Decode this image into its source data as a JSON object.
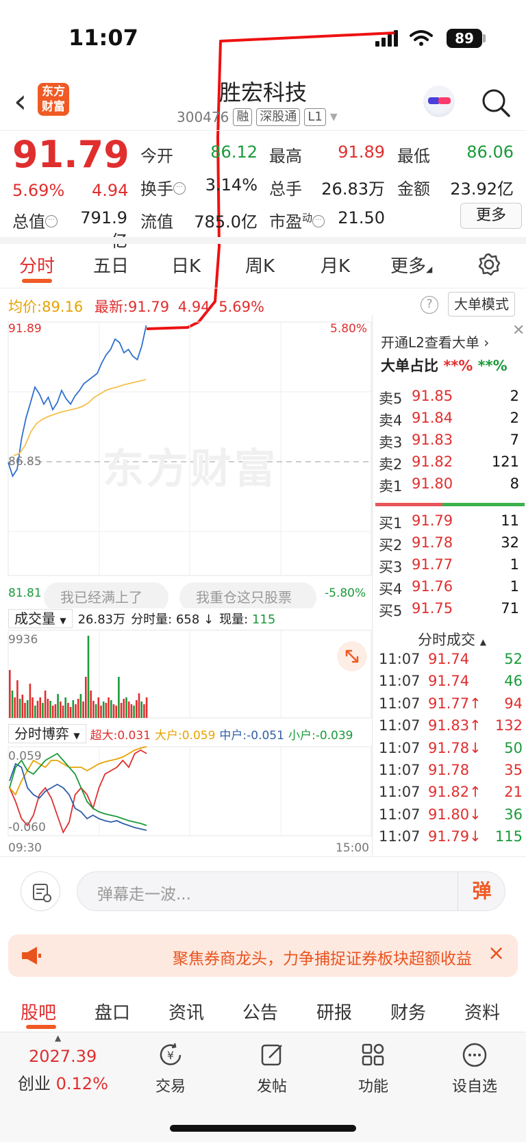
{
  "status_bar": {
    "time": "11:07",
    "battery": "89"
  },
  "header": {
    "logo_line1": "东方",
    "logo_line2": "财富",
    "name": "胜宏科技",
    "code": "300476",
    "tags": [
      "融",
      "深股通",
      "L1"
    ]
  },
  "quote": {
    "price": "91.79",
    "change_pct": "5.69%",
    "change": "4.94",
    "rows": [
      [
        {
          "label": "今开",
          "value": "86.12",
          "color": "green"
        },
        {
          "label": "最高",
          "value": "91.89",
          "color": "red"
        },
        {
          "label": "最低",
          "value": "86.06",
          "color": "green"
        }
      ],
      [
        {
          "label": "换手",
          "value": "3.14%",
          "color": "black"
        },
        {
          "label": "总手",
          "value": "26.83万",
          "color": "black"
        },
        {
          "label": "金额",
          "value": "23.92亿",
          "color": "black"
        }
      ],
      [
        {
          "label": "总值",
          "value": "791.9亿",
          "color": "black"
        },
        {
          "label": "流值",
          "value": "785.0亿",
          "color": "black"
        },
        {
          "label": "市盈",
          "value": "21.50",
          "color": "black",
          "sup": "动"
        }
      ]
    ],
    "more_label": "更多"
  },
  "tabs": [
    "分时",
    "五日",
    "日K",
    "周K",
    "月K",
    "更多"
  ],
  "info_row": {
    "avg_label": "均价:",
    "avg_value": "89.16",
    "latest_label": "最新:",
    "latest_value": "91.79",
    "change": "4.94",
    "change_pct": "5.69%",
    "mode_label": "大单模式"
  },
  "price_chart": {
    "high_price": "91.89",
    "high_pct": "5.80%",
    "mid_price": "86.85",
    "low_price": "81.81",
    "low_pct": "-5.80%",
    "watermark": "东方财富",
    "pills": [
      "我已经满上了",
      "我重仓这只股票"
    ]
  },
  "volume": {
    "dropdown": "成交量",
    "total": "26.83万",
    "minute_label": "分时量:",
    "minute_value": "658",
    "current_label": "现量:",
    "current_value": "115",
    "max_label": "9936"
  },
  "game": {
    "dropdown": "分时博弈",
    "items": [
      {
        "label": "超大:",
        "value": "0.031",
        "color": "#e02e2e"
      },
      {
        "label": "大户:",
        "value": "0.059",
        "color": "#e6a300"
      },
      {
        "label": "中户:",
        "value": "-0.051",
        "color": "#2f5ea8"
      },
      {
        "label": "小户:",
        "value": "-0.039",
        "color": "#1a9a3a"
      }
    ],
    "max_label": "0.059",
    "min_label": "-0.060",
    "start_time": "09:30",
    "end_time": "15:00"
  },
  "right_panel": {
    "l2_text": "开通L2查看大单",
    "big_ratio_label": "大单占比",
    "big_ratio_red": "**%",
    "big_ratio_green": "**%",
    "sells": [
      {
        "label": "卖5",
        "price": "91.85",
        "vol": "2"
      },
      {
        "label": "卖4",
        "price": "91.84",
        "vol": "2"
      },
      {
        "label": "卖3",
        "price": "91.83",
        "vol": "7"
      },
      {
        "label": "卖2",
        "price": "91.82",
        "vol": "121"
      },
      {
        "label": "卖1",
        "price": "91.80",
        "vol": "8"
      }
    ],
    "buys": [
      {
        "label": "买1",
        "price": "91.79",
        "vol": "11"
      },
      {
        "label": "买2",
        "price": "91.78",
        "vol": "32"
      },
      {
        "label": "买3",
        "price": "91.77",
        "vol": "1"
      },
      {
        "label": "买4",
        "price": "91.76",
        "vol": "1"
      },
      {
        "label": "买5",
        "price": "91.75",
        "vol": "71"
      }
    ],
    "trades_title": "分时成交",
    "trades": [
      {
        "time": "11:07",
        "price": "91.74",
        "vol": "52",
        "vcolor": "green"
      },
      {
        "time": "11:07",
        "price": "91.74",
        "vol": "46",
        "vcolor": "green"
      },
      {
        "time": "11:07",
        "price": "91.77↑",
        "vol": "94",
        "vcolor": "red"
      },
      {
        "time": "11:07",
        "price": "91.83↑",
        "vol": "132",
        "vcolor": "red"
      },
      {
        "time": "11:07",
        "price": "91.78↓",
        "vol": "50",
        "vcolor": "green"
      },
      {
        "time": "11:07",
        "price": "91.78",
        "vol": "35",
        "vcolor": "red"
      },
      {
        "time": "11:07",
        "price": "91.82↑",
        "vol": "21",
        "vcolor": "red"
      },
      {
        "time": "11:07",
        "price": "91.80↓",
        "vol": "36",
        "vcolor": "green"
      },
      {
        "time": "11:07",
        "price": "91.79↓",
        "vol": "115",
        "vcolor": "green"
      }
    ]
  },
  "comment": {
    "placeholder": "弹幕走一波...",
    "danmu": "弹"
  },
  "banner": {
    "text": "聚焦券商龙头，力争捕捉证券板块超额收益"
  },
  "bottom_tabs": [
    "股吧",
    "盘口",
    "资讯",
    "公告",
    "研报",
    "财务",
    "资料"
  ],
  "footer": {
    "index_value": "2027.39",
    "index_name": "创业",
    "index_pct": "0.12%",
    "buttons": [
      "交易",
      "发帖",
      "功能",
      "设自选"
    ]
  },
  "colors": {
    "up": "#e02e2e",
    "down": "#1a9a3a",
    "accent": "#f05a24",
    "avg_line": "#f5c04a",
    "price_line": "#2f6fd0"
  }
}
